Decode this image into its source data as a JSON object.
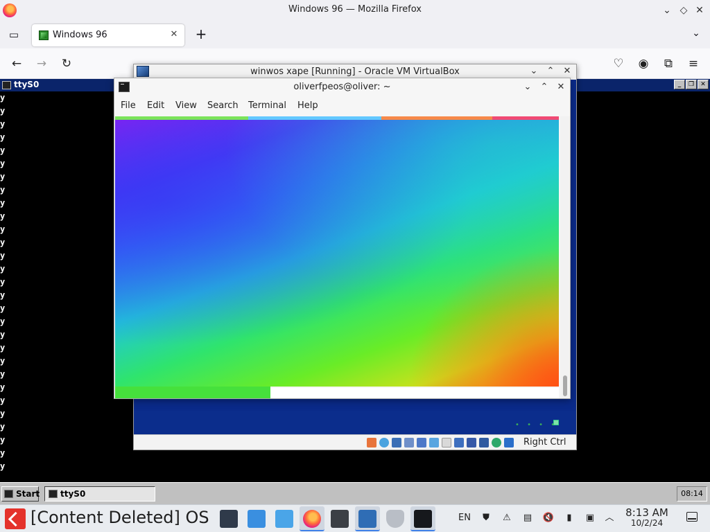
{
  "firefox": {
    "window_title": "Windows 96 — Mozilla Firefox",
    "tab_title": "Windows 96",
    "tab_close": "✕",
    "new_tab": "+",
    "icons": [
      "firefox-logo",
      "tab-list-icon",
      "back-icon",
      "forward-icon",
      "reload-icon",
      "pocket-icon",
      "account-icon",
      "extensions-icon",
      "menu-icon"
    ]
  },
  "win96": {
    "window_title": "ttyS0",
    "terminal_lines_char": "y",
    "start_label": "Start",
    "task_label": "ttyS0",
    "clock": "08:14",
    "title_buttons": [
      "_",
      "❐",
      "✕"
    ]
  },
  "virtualbox": {
    "title": "winwos xape [Running] - Oracle VM VirtualBox",
    "host_key": "Right Ctrl"
  },
  "terminal": {
    "title": "oliverfpeos@oliver: ~",
    "menu": {
      "file": "File",
      "edit": "Edit",
      "view": "View",
      "search": "Search",
      "terminal": "Terminal",
      "help": "Help"
    }
  },
  "host_taskbar": {
    "menu_label": "[Content Deleted] OS",
    "lang": "EN",
    "time": "8:13 AM",
    "date": "10/2/24"
  },
  "colors": {
    "win96_titlebar": "#0a246a",
    "vbox_display": "#0a2a8a",
    "accent": "#3e80e8"
  }
}
